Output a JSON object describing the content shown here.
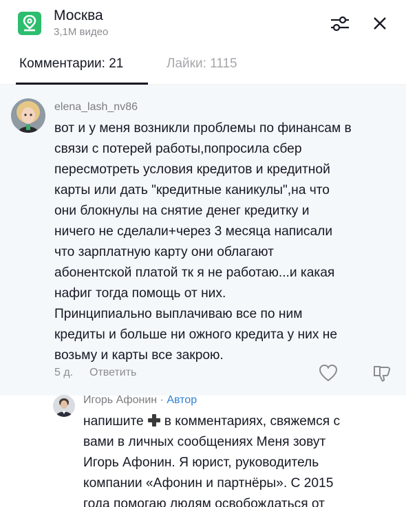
{
  "header": {
    "title": "Москва",
    "subtitle": "3,1М видео",
    "location_icon": "map-pin-icon",
    "filter_icon": "sliders-icon",
    "close_icon": "close-icon",
    "accent_color": "#2dbd6e"
  },
  "tabs": {
    "comments_label": "Комментарии: 21",
    "likes_label": "Лайки: 1115"
  },
  "comment": {
    "username": "elena_lash_nv86",
    "lines": [
      "вот и у меня возникли проблемы по финансам в",
      "связи с потерей работы,попросила сбер",
      "пересмотреть условия кредитов и кредитной",
      "карты или дать \"кредитные каникулы\",на что",
      "они блокнулы на снятие денег кредитку и",
      "ничего не сделали+через 3 месяца написали",
      "что зарплатную карту они облагают",
      "абонентской платой тк я не работаю...и какая",
      "нафиг тогда помощь от них.",
      "Принципиально выплачиваю все по ним",
      "кредиты и больше ни ожного кредита у них не",
      "возьму и карты все закрою."
    ],
    "time": "5 д.",
    "reply_label": "Ответить",
    "highlight_bg": "#f4f8fb"
  },
  "reply": {
    "username": "Игорь Афонин",
    "separator": "·",
    "author_label": "Автор",
    "author_color": "#2f7fd6",
    "first_line_before": "напишите",
    "first_line_after": "в комментариях, свяжемся с",
    "lines": [
      "вами в личных сообщениях Меня зовут",
      "Игорь Афонин. Я юрист, руководитель",
      "компании «Афонин и партнёры». С 2015",
      "года помогаю людям освобождаться от"
    ]
  }
}
